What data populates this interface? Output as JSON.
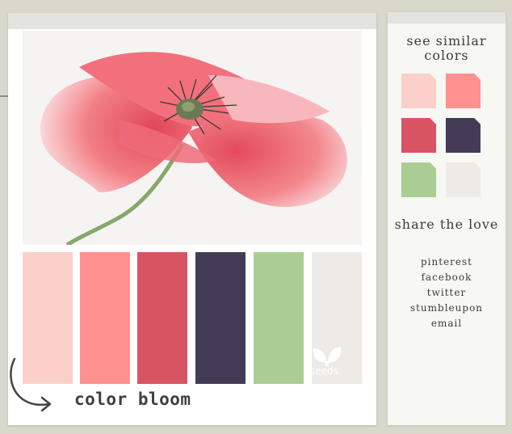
{
  "palette": {
    "colors": [
      {
        "name": "light-pink",
        "hex": "#fbd0cb"
      },
      {
        "name": "salmon",
        "hex": "#fe9190"
      },
      {
        "name": "red",
        "hex": "#d95463"
      },
      {
        "name": "dark-purple",
        "hex": "#443c56"
      },
      {
        "name": "green",
        "hex": "#aacd93"
      },
      {
        "name": "light-gray",
        "hex": "#ecebe6"
      }
    ],
    "caption": "color bloom",
    "logo_text": "seeds"
  },
  "sidebar": {
    "similar_heading": "see similar colors",
    "similar_colors": [
      "#fbd0cb",
      "#fe9190",
      "#d95463",
      "#443c56",
      "#aacd93",
      "#ecebe6"
    ],
    "share_heading": "share the love",
    "share_links": [
      "pinterest",
      "facebook",
      "twitter",
      "stumbleupon",
      "email"
    ]
  },
  "icons": {
    "photo": "poppy-flower-photo",
    "arrow": "curved-arrow-icon",
    "logo": "seeds-leaf-logo"
  }
}
